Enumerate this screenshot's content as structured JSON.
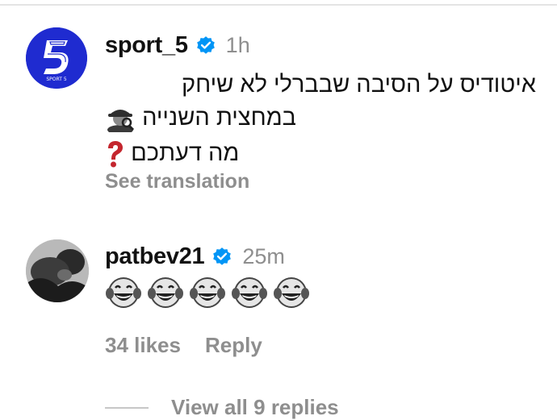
{
  "comment1": {
    "username": "sport_5",
    "time": "1h",
    "lines": [
      "איטודיס על הסיבה שבברלי לא שיחק",
      "במחצית השנייה",
      "מה דעתכם"
    ],
    "see_translation": "See translation",
    "avatar_logo": "5",
    "brand_color": "#1f2bd0",
    "icons": [
      "detective-emoji",
      "red-question-mark-emoji"
    ]
  },
  "comment2": {
    "username": "patbev21",
    "time": "25m",
    "emoji": [
      "😂",
      "😂",
      "😂",
      "😂",
      "😂"
    ],
    "likes": "34 likes",
    "reply": "Reply",
    "view_replies": "View all 9 replies"
  },
  "colors": {
    "verified": "#0095f6",
    "muted": "#8e8e8e"
  }
}
